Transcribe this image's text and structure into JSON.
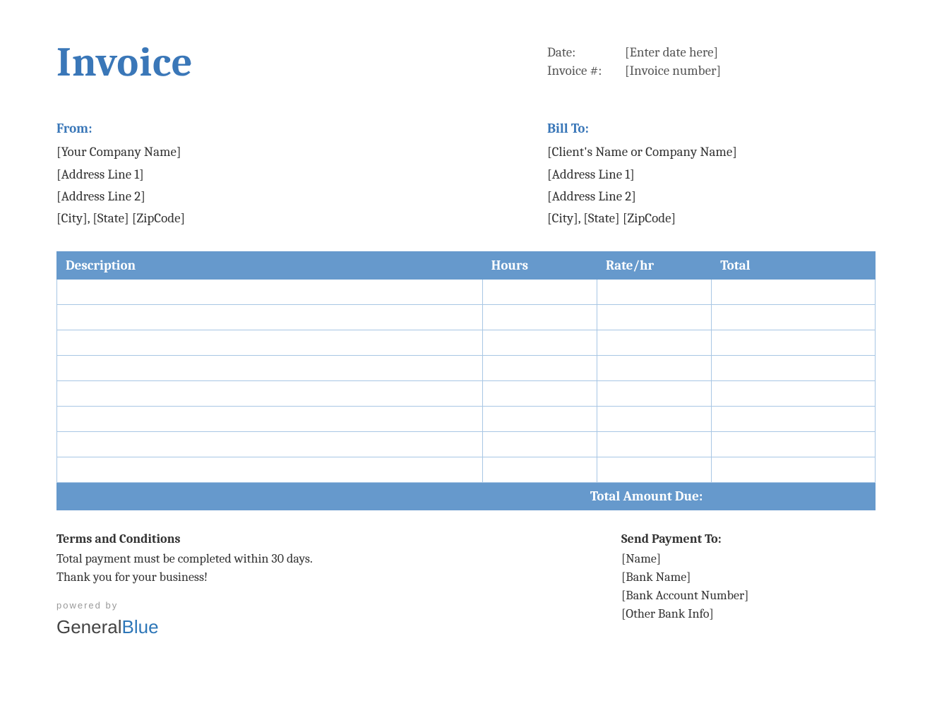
{
  "title": "Invoice",
  "meta": {
    "date_label": "Date:",
    "date_value": "[Enter date here]",
    "invoice_num_label": "Invoice #:",
    "invoice_num_value": "[Invoice number]"
  },
  "from": {
    "heading": "From:",
    "lines": [
      "[Your Company Name]",
      "[Address Line 1]",
      "[Address Line 2]",
      "[City], [State] [ZipCode]"
    ]
  },
  "bill_to": {
    "heading": "Bill To:",
    "lines": [
      "[Client's Name or Company Name]",
      "[Address Line 1]",
      "[Address Line 2]",
      "[City], [State] [ZipCode]"
    ]
  },
  "table": {
    "headers": {
      "description": "Description",
      "hours": "Hours",
      "rate": "Rate/hr",
      "total": "Total"
    },
    "rows": [
      {
        "description": "",
        "hours": "",
        "rate": "",
        "total": ""
      },
      {
        "description": "",
        "hours": "",
        "rate": "",
        "total": ""
      },
      {
        "description": "",
        "hours": "",
        "rate": "",
        "total": ""
      },
      {
        "description": "",
        "hours": "",
        "rate": "",
        "total": ""
      },
      {
        "description": "",
        "hours": "",
        "rate": "",
        "total": ""
      },
      {
        "description": "",
        "hours": "",
        "rate": "",
        "total": ""
      },
      {
        "description": "",
        "hours": "",
        "rate": "",
        "total": ""
      },
      {
        "description": "",
        "hours": "",
        "rate": "",
        "total": ""
      }
    ],
    "total_label": "Total Amount Due:",
    "total_value": ""
  },
  "terms": {
    "heading": "Terms and Conditions",
    "line1": "Total payment must be completed within 30 days.",
    "line2": "Thank you for your business!"
  },
  "payment": {
    "heading": "Send Payment To:",
    "lines": [
      "[Name]",
      "[Bank Name]",
      "[Bank Account Number]",
      "[Other Bank Info]"
    ]
  },
  "powered": {
    "by": "powered by",
    "brand_general": "General",
    "brand_blue": "Blue"
  }
}
